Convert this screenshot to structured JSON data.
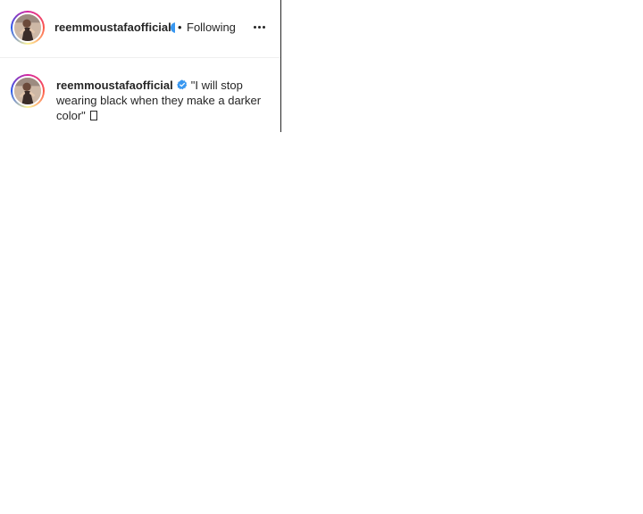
{
  "post": {
    "header": {
      "username": "reemmoustafaofficial",
      "separator": "•",
      "follow_status": "Following",
      "verified_icon": "verified-badge-icon",
      "more_icon": "more-options-icon"
    },
    "caption": {
      "username": "reemmoustafaofficial",
      "verified_icon": "verified-badge-icon",
      "text": "\"I will stop wearing black when they make a darker color\"",
      "trailing_glyph": "emoji-missing-glyph"
    }
  },
  "colors": {
    "text": "#262626",
    "verified_blue": "#3897f0",
    "divider": "#efefef",
    "story_ring": [
      "#d6249f",
      "#fd5949",
      "#fdf497",
      "#285aeb"
    ]
  }
}
